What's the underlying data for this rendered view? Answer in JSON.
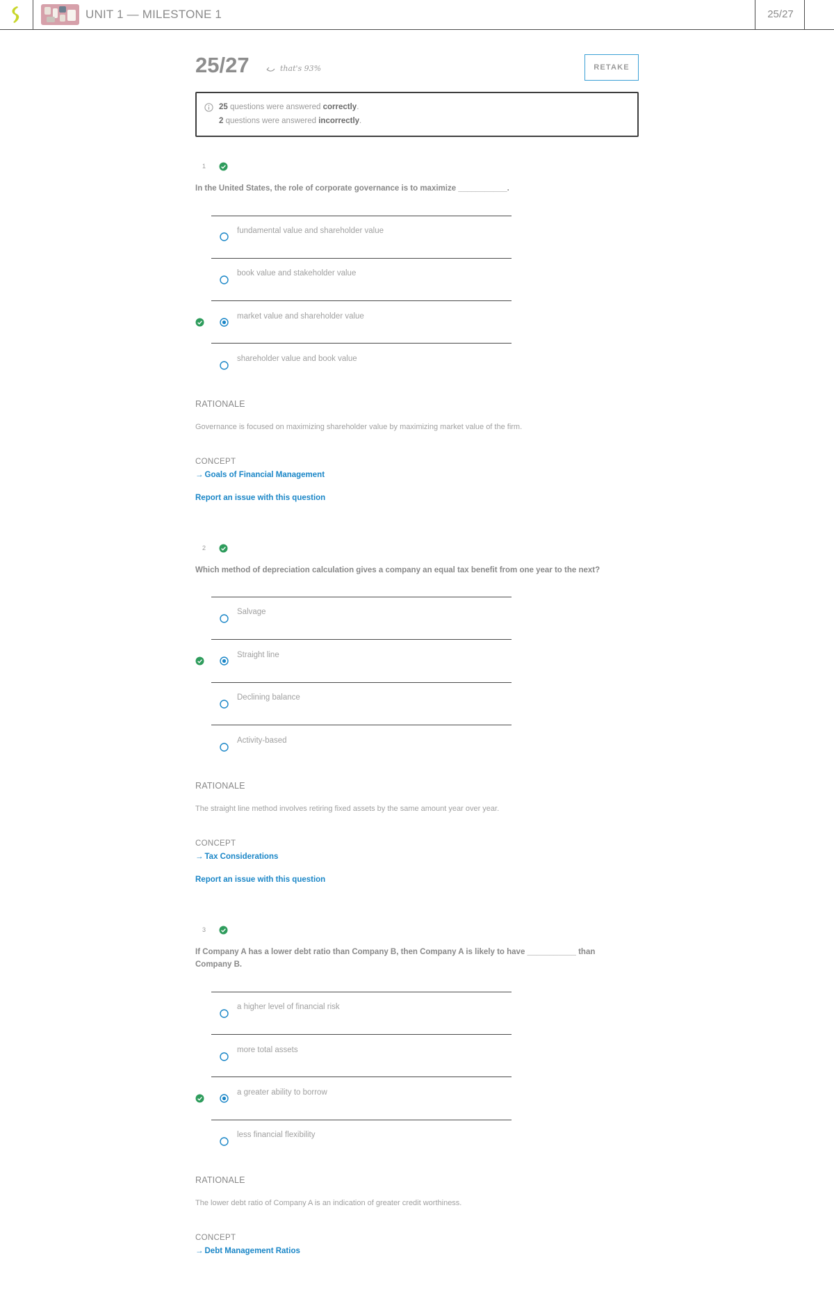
{
  "header": {
    "title": "UNIT 1 — MILESTONE 1",
    "score": "25/27",
    "logo_icon": "sophia-logo-icon",
    "thumbnail_icon": "milestone-thumbnail-image"
  },
  "results": {
    "score": "25/27",
    "percent_note": "that's 93%",
    "retake_label": "RETAKE",
    "correct_count": "25",
    "correct_text_a": "questions were answered",
    "correct_word": "correctly",
    "incorrect_count": "2",
    "incorrect_text_a": "questions were answered",
    "incorrect_word": "incorrectly"
  },
  "labels": {
    "rationale": "RATIONALE",
    "concept": "CONCEPT",
    "report": "Report an issue with this question",
    "arrow": "→"
  },
  "colors": {
    "accent_blue": "#1a86c7",
    "correct_green": "#2e9c5c",
    "retake_border": "#3a9fd6",
    "logo_yellow": "#c8d62a"
  },
  "questions": [
    {
      "number": "1",
      "status": "correct",
      "text": "In the United States, the role of corporate governance is to maximize ___________.",
      "options": [
        {
          "label": "fundamental value and shareholder value",
          "selected": false,
          "correct": false
        },
        {
          "label": "book value and stakeholder value",
          "selected": false,
          "correct": false
        },
        {
          "label": "market value and shareholder value",
          "selected": true,
          "correct": true
        },
        {
          "label": "shareholder value and book value",
          "selected": false,
          "correct": false
        }
      ],
      "rationale": "Governance is focused on maximizing shareholder value by maximizing market value of the firm.",
      "concept": "Goals of Financial Management"
    },
    {
      "number": "2",
      "status": "correct",
      "text": "Which method of depreciation calculation gives a company an equal tax benefit from one year to the next?",
      "options": [
        {
          "label": "Salvage",
          "selected": false,
          "correct": false
        },
        {
          "label": "Straight line",
          "selected": true,
          "correct": true
        },
        {
          "label": "Declining balance",
          "selected": false,
          "correct": false
        },
        {
          "label": "Activity-based",
          "selected": false,
          "correct": false
        }
      ],
      "rationale": "The straight line method involves retiring fixed assets by the same amount year over year.",
      "concept": "Tax Considerations"
    },
    {
      "number": "3",
      "status": "correct",
      "text_line1": "If Company A has a lower debt ratio than Company B, then Company A is likely to have ___________ than",
      "text_line2": "Company B.",
      "options": [
        {
          "label": "a higher level of financial risk",
          "selected": false,
          "correct": false
        },
        {
          "label": "more total assets",
          "selected": false,
          "correct": false
        },
        {
          "label": "a greater ability to borrow",
          "selected": true,
          "correct": true
        },
        {
          "label": "less financial flexibility",
          "selected": false,
          "correct": false
        }
      ],
      "rationale": "The lower debt ratio of Company A is an indication of greater credit worthiness.",
      "concept": "Debt Management Ratios"
    }
  ]
}
